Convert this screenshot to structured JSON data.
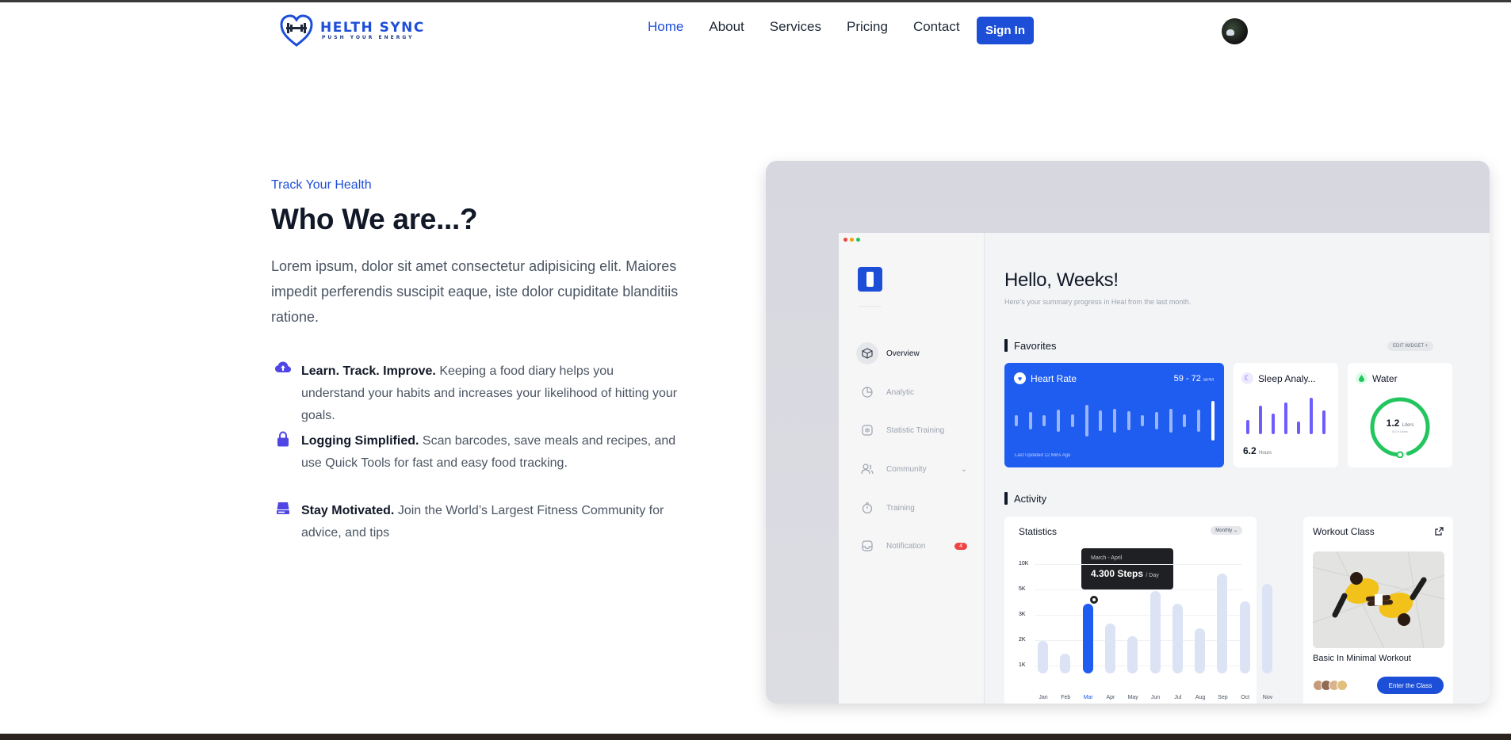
{
  "brand": {
    "name": "HELTH SYNC",
    "tagline": "PUSH YOUR ENERGY",
    "color": "#1d4ed8"
  },
  "nav": {
    "items": [
      {
        "label": "Home",
        "active": true
      },
      {
        "label": "About",
        "active": false
      },
      {
        "label": "Services",
        "active": false
      },
      {
        "label": "Pricing",
        "active": false
      },
      {
        "label": "Contact",
        "active": false
      }
    ],
    "signin_label": "Sign In"
  },
  "hero": {
    "eyebrow": "Track Your Health",
    "title": "Who We are...?",
    "lead": "Lorem ipsum, dolor sit amet consectetur adipisicing elit. Maiores impedit perferendis suscipit eaque, iste dolor cupiditate blanditiis ratione.",
    "features": [
      {
        "icon": "cloud-upload-icon",
        "title": "Learn. Track. Improve.",
        "text": "Keeping a food diary helps you understand your habits and increases your likelihood of hitting your goals."
      },
      {
        "icon": "lock-icon",
        "title": "Logging Simplified.",
        "text": "Scan barcodes, save meals and recipes, and use Quick Tools for fast and easy food tracking."
      },
      {
        "icon": "database-icon",
        "title": "Stay Motivated.",
        "text": "Join the World’s Largest Fitness Community for advice, and tips"
      }
    ]
  },
  "dashboard": {
    "menu": [
      {
        "label": "Overview",
        "icon": "cube-icon",
        "active": true
      },
      {
        "label": "Analytic",
        "icon": "pie-chart-icon",
        "active": false
      },
      {
        "label": "Statistic Training",
        "icon": "bars-icon",
        "active": false
      },
      {
        "label": "Community",
        "icon": "users-icon",
        "active": false,
        "chevron": true
      },
      {
        "label": "Training",
        "icon": "stopwatch-icon",
        "active": false
      },
      {
        "label": "Notification",
        "icon": "inbox-icon",
        "active": false,
        "badge": "4"
      }
    ],
    "greeting": "Hello, Weeks!",
    "subtitle": "Here’s your summary progress in Heal from the last month.",
    "favorites_title": "Favorites",
    "edit_widget": "EDIT WIDGET",
    "heart_rate": {
      "title": "Heart Rate",
      "range": "59 - 72",
      "unit": "BPM",
      "footer": "Last Updated 12 Mins Ago"
    },
    "sleep": {
      "title": "Sleep Analy...",
      "value": "6.2",
      "unit": "Hours"
    },
    "water": {
      "title": "Water",
      "value": "1.2",
      "unit": "Liters",
      "goal": "0/2.5 Liters",
      "fraction": 0.95
    },
    "activity_title": "Activity",
    "statistics": {
      "title": "Statistics",
      "period": "Monthly",
      "tooltip_range": "March - April",
      "tooltip_value": "4.300 Steps",
      "tooltip_unit": "/ Day"
    },
    "workout": {
      "title": "Workout Class",
      "name": "Basic In Minimal Workout",
      "button": "Enter the Class"
    }
  },
  "chart_data": {
    "type": "bar",
    "title": "Statistics",
    "categories": [
      "Jan",
      "Feb",
      "Mar",
      "Apr",
      "May",
      "Jun",
      "Jul",
      "Aug",
      "Sep",
      "Oct",
      "Nov"
    ],
    "values": [
      1.3,
      0.8,
      2.8,
      2.0,
      1.5,
      3.3,
      2.8,
      1.8,
      4.0,
      2.9,
      3.6
    ],
    "highlight": "Mar",
    "y_ticks": [
      "1K",
      "2K",
      "3K",
      "5K",
      "10K"
    ],
    "ylim": [
      0,
      4.2
    ],
    "grid": true,
    "colors": {
      "bar": "#dbe3f4",
      "highlight": "#1f5cf0"
    }
  }
}
